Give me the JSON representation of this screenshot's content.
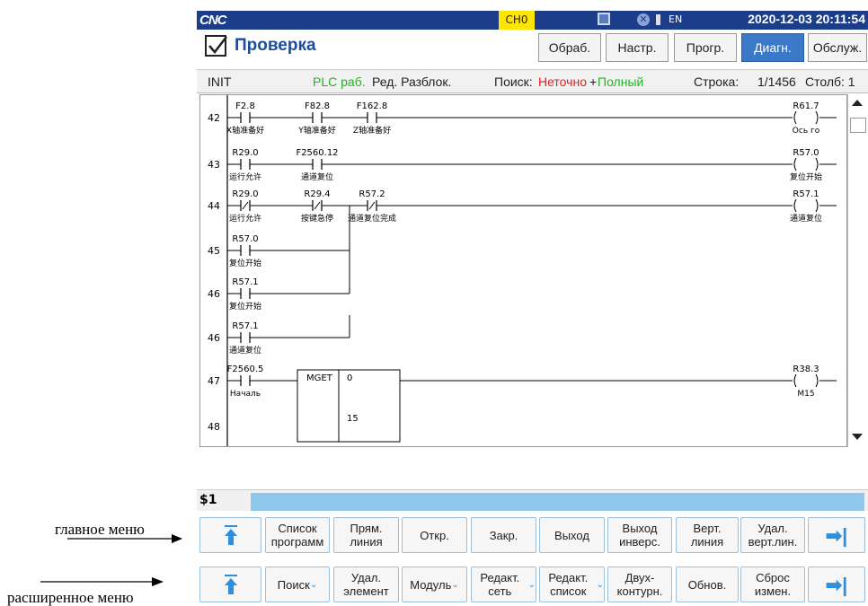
{
  "annotations": {
    "main_menu": "главное меню",
    "extended_menu": "расширенное меню"
  },
  "titlebar": {
    "logo": "CNC",
    "channel": "CH0",
    "lang": "EN",
    "datetime": "2020-12-03 20:11:54"
  },
  "header": {
    "title": "Проверка",
    "buttons": [
      "Обраб.",
      "Настр.",
      "Прогр.",
      "Диагн.",
      "Обслуж."
    ],
    "active": "Диагн."
  },
  "status": {
    "mode": "INIT",
    "plc": "PLC раб.",
    "edit": "Ред. Разблок.",
    "search_label": "Поиск:",
    "search_fuzzy": "Неточно",
    "plus": "+",
    "search_full": "Полный",
    "row_label": "Строка:",
    "row_value": "1/1456",
    "col_label": "Столб: 1"
  },
  "ladder": {
    "rows": [
      {
        "num": "42",
        "contacts": [
          {
            "addr": "F2.8",
            "label": "X轴准备好",
            "nc": false
          },
          {
            "addr": "F82.8",
            "label": "Y轴准备好",
            "nc": false
          },
          {
            "addr": "F162.8",
            "label": "Z轴准备好",
            "nc": false
          }
        ],
        "coil": {
          "addr": "R61.7",
          "label": "Ось го"
        }
      },
      {
        "num": "43",
        "contacts": [
          {
            "addr": "R29.0",
            "label": "运行允许",
            "nc": false
          },
          {
            "addr": "F2560.12",
            "label": "通道复位",
            "nc": false
          }
        ],
        "coil": {
          "addr": "R57.0",
          "label": "复位开始"
        }
      },
      {
        "num": "44",
        "contacts": [
          {
            "addr": "R29.0",
            "label": "运行允许",
            "nc": true
          },
          {
            "addr": "R29.4",
            "label": "按键急停",
            "nc": true
          },
          {
            "addr": "R57.2",
            "label": "通道复位完成",
            "nc": true
          }
        ],
        "coil": {
          "addr": "R57.1",
          "label": "通道复位"
        }
      },
      {
        "num": "45",
        "contacts": [
          {
            "addr": "R57.0",
            "label": "复位开始",
            "nc": false
          }
        ]
      },
      {
        "num": "46",
        "contacts": [
          {
            "addr": "R57.1",
            "label": "复位开始",
            "nc": false
          }
        ]
      },
      {
        "num": "46",
        "contacts": [
          {
            "addr": "R57.1",
            "label": "通道复位",
            "nc": false
          }
        ]
      },
      {
        "num": "47",
        "contacts": [
          {
            "addr": "F2560.5",
            "label": "Началь",
            "nc": false
          }
        ],
        "block": {
          "name": "MGET",
          "p1": "0",
          "p2": "15"
        },
        "coil": {
          "addr": "R38.3",
          "label": "M15"
        }
      },
      {
        "num": "48",
        "contacts": []
      }
    ]
  },
  "command": {
    "prompt": "$1"
  },
  "main_menu": [
    "Список программ",
    "Прям. линия",
    "Откр.",
    "Закр.",
    "Выход",
    "Выход инверс.",
    "Верт. линия",
    "Удал. верт.лин."
  ],
  "ext_menu": [
    "Поиск",
    "Удал. элемент",
    "Модуль",
    "Редакт. сеть",
    "Редакт. список",
    "Двух- контурн.",
    "Обнов.",
    "Сброс измен."
  ],
  "colors": {
    "title_bg": "#1c3d8a",
    "active_tab": "#3b78c8",
    "plc_green": "#22b422",
    "fuzzy_red": "#e02020",
    "cmd_bar": "#8fc8ea"
  }
}
